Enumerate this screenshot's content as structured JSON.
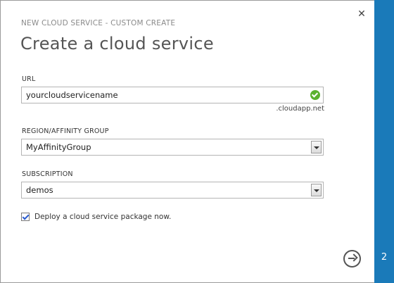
{
  "dialog": {
    "subtitle": "NEW CLOUD SERVICE - CUSTOM CREATE",
    "title": "Create a cloud service",
    "close_icon": "close-icon"
  },
  "url": {
    "label": "URL",
    "value": "yourcloudservicename",
    "status_icon": "valid-check-icon",
    "suffix": ".cloudapp.net"
  },
  "region": {
    "label": "REGION/AFFINITY GROUP",
    "selected": "MyAffinityGroup"
  },
  "subscription": {
    "label": "SUBSCRIPTION",
    "selected": "demos"
  },
  "deploy": {
    "checked": true,
    "label": "Deploy a cloud service package now."
  },
  "footer": {
    "next_icon": "next-arrow-icon",
    "step": "2"
  },
  "colors": {
    "accent": "#1a7ab9",
    "valid": "#5bb12f"
  }
}
